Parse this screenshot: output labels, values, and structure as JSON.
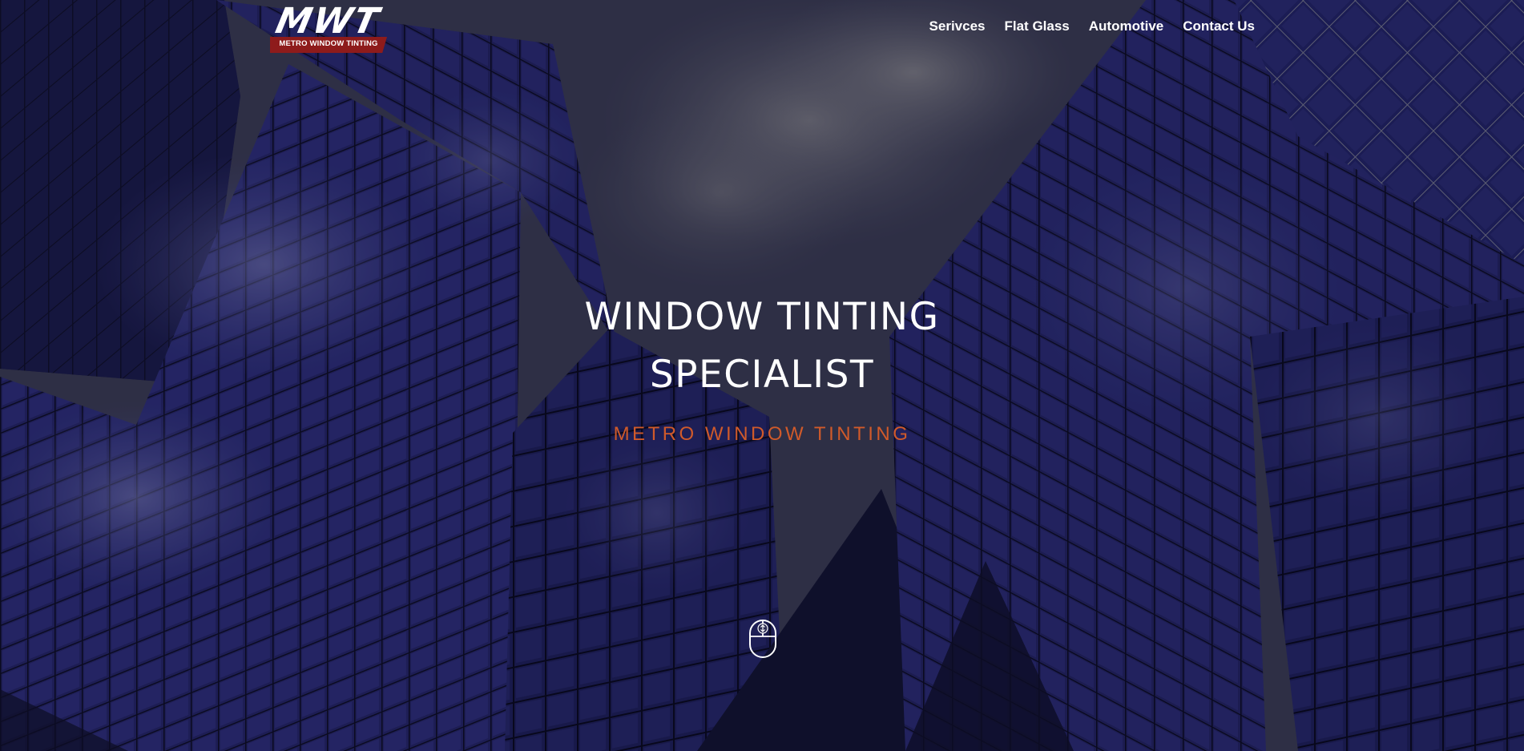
{
  "header": {
    "logo": {
      "letters": "MWT",
      "subtitle": "METRO WINDOW TINTING"
    },
    "nav": [
      {
        "label": "Serivces"
      },
      {
        "label": "Flat Glass"
      },
      {
        "label": "Automotive"
      },
      {
        "label": "Contact Us"
      }
    ]
  },
  "hero": {
    "title_line1": "WINDOW TINTING",
    "title_line2": "SPECIALIST",
    "subtitle": "METRO WINDOW TINTING",
    "scroll_icon": "mouse-scroll-icon"
  },
  "colors": {
    "accent": "#d05a2a",
    "logo_band": "#8e1b1b",
    "text": "#ffffff",
    "background": "#16173a"
  }
}
